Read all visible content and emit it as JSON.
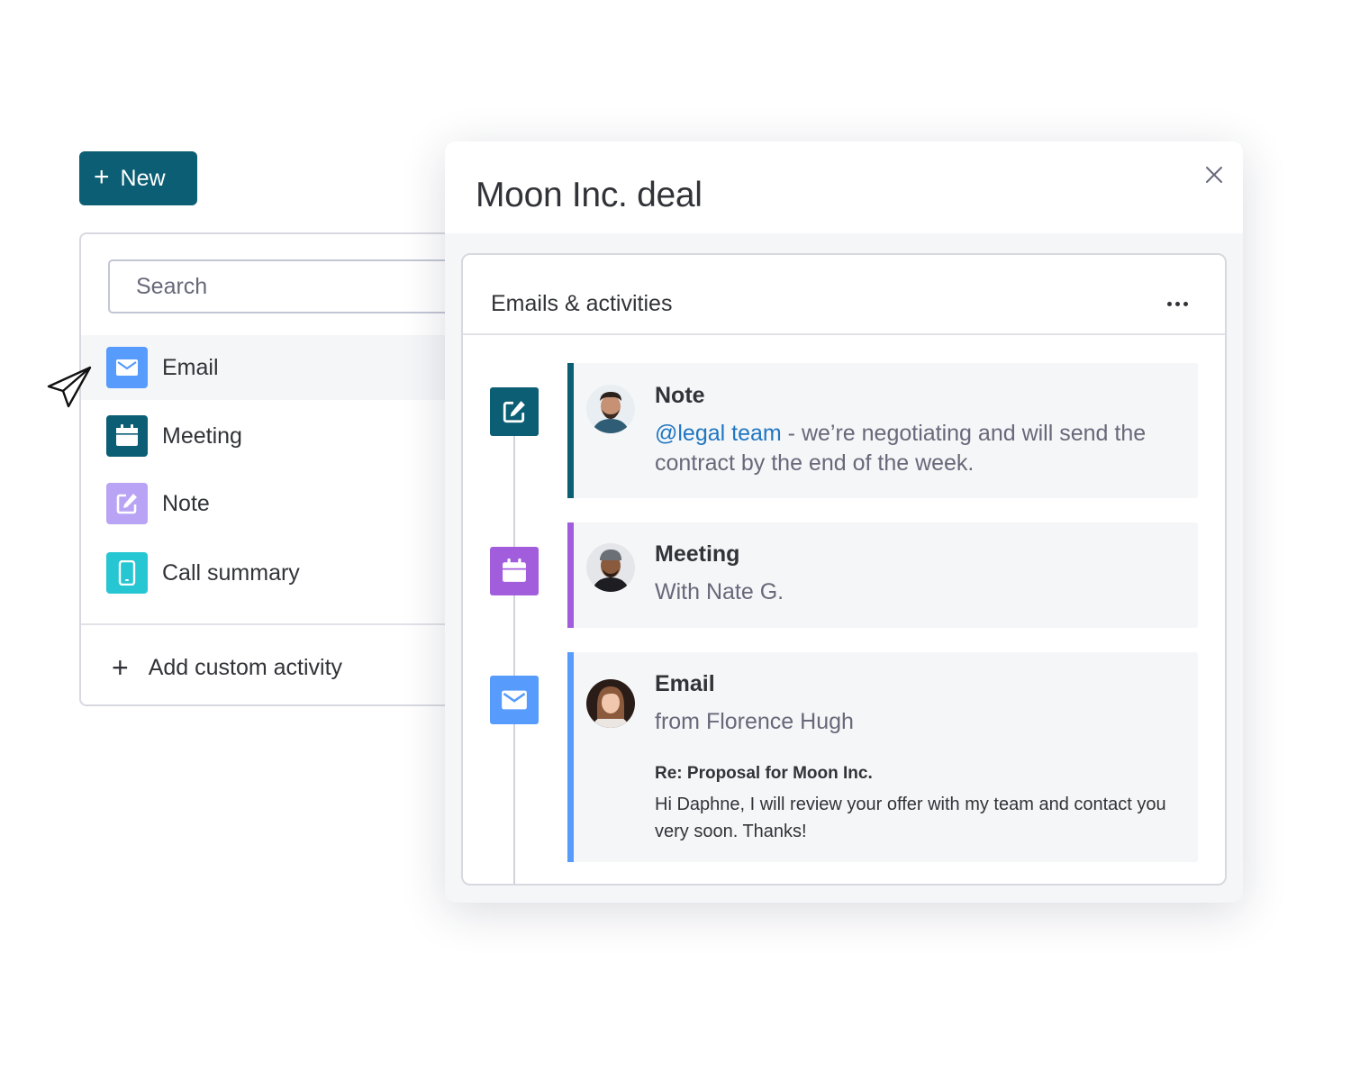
{
  "new_button": {
    "label": "New"
  },
  "left_panel": {
    "search_placeholder": "Search",
    "items": [
      {
        "label": "Email",
        "icon": "mail-icon",
        "color": "#579bfc"
      },
      {
        "label": "Meeting",
        "icon": "calendar-icon",
        "color": "#0b5e73"
      },
      {
        "label": "Note",
        "icon": "edit-note-icon",
        "color": "#b9a3f5"
      },
      {
        "label": "Call summary",
        "icon": "phone-icon",
        "color": "#26c6d2"
      }
    ],
    "add_custom": "Add custom activity"
  },
  "card": {
    "title": "Moon Inc. deal",
    "section_title": "Emails & activities",
    "entries": [
      {
        "type": "Note",
        "accent": "#0b5e73",
        "mention": "@legal team",
        "body": " - we’re negotiating and will send the contract by the end of the week."
      },
      {
        "type": "Meeting",
        "accent": "#a25ddc",
        "subtitle": "With Nate G."
      },
      {
        "type": "Email",
        "accent": "#579bfc",
        "subtitle": "from Florence Hugh",
        "subject": "Re: Proposal for Moon Inc.",
        "text": "Hi Daphne, I will review your offer with my team and contact you very soon. Thanks!"
      }
    ]
  }
}
